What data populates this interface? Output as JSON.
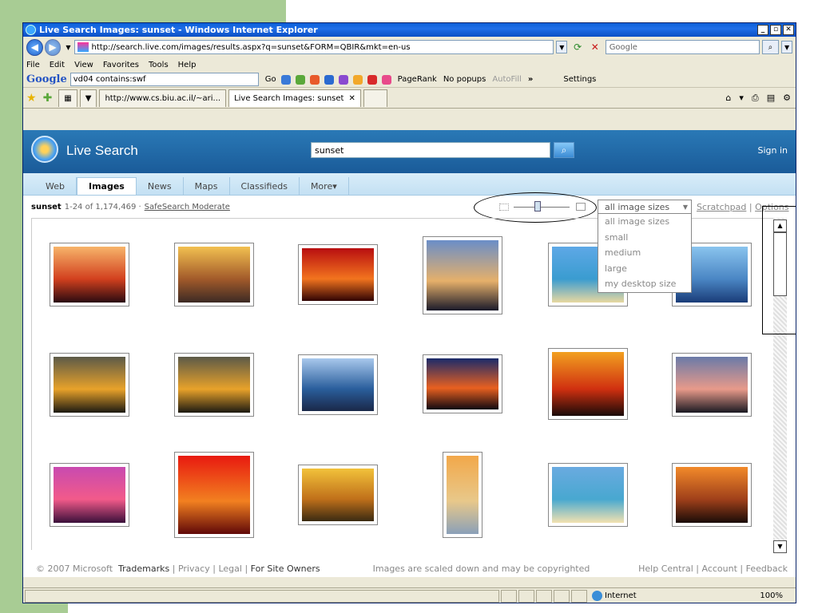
{
  "window": {
    "title": "Live Search Images: sunset - Windows Internet Explorer",
    "url": "http://search.live.com/images/results.aspx?q=sunset&FORM=QBIR&mkt=en-us",
    "search_box_text": "Google"
  },
  "menu": [
    "File",
    "Edit",
    "View",
    "Favorites",
    "Tools",
    "Help"
  ],
  "google_toolbar": {
    "logo": "Google",
    "search_text": "vd04 contains:swf",
    "go_label": "Go",
    "pagerank_label": "PageRank",
    "popups_label": "No popups",
    "autofill_label": "AutoFill",
    "more_label": "»",
    "settings_label": "Settings"
  },
  "tabs": [
    {
      "label": "http://www.cs.biu.ac.il/~ari...",
      "active": false
    },
    {
      "label": "Live Search Images: sunset",
      "active": true
    }
  ],
  "live_search": {
    "brand": "Live Search",
    "query": "sunset",
    "sign_in": "Sign in",
    "nav": [
      "Web",
      "Images",
      "News",
      "Maps",
      "Classifieds",
      "More▾"
    ],
    "selected_nav": "Images",
    "result_query": "sunset",
    "result_count": "1-24 of 1,174,469 ·",
    "safesearch": "SafeSearch Moderate",
    "size_select": "all image sizes",
    "size_options": [
      "all image sizes",
      "small",
      "medium",
      "large",
      "my desktop size"
    ],
    "scratchpad": "Scratchpad",
    "separator": "|",
    "options": "Options"
  },
  "footer": {
    "copyright": "© 2007 Microsoft",
    "links": [
      "Trademarks",
      "Privacy",
      "Legal",
      "For Site Owners"
    ],
    "disclaimer": "Images are scaled down and may be copyrighted",
    "right_links": [
      "Help Central",
      "Account",
      "Feedback"
    ]
  },
  "status": {
    "zone": "Internet",
    "zoom": "100%"
  },
  "colors": {
    "header_blue": "#1a5b99",
    "nav_light_blue": "#c3e0f3"
  },
  "thumbnails": [
    {
      "name": "palm-tree-sunset",
      "colors": [
        "#f7b46a",
        "#d2401e",
        "#2a0a10"
      ]
    },
    {
      "name": "pier-sunset",
      "colors": [
        "#f2c050",
        "#a25a2a",
        "#3c2a24"
      ]
    },
    {
      "name": "red-horizon-sunset",
      "colors": [
        "#b80e10",
        "#f2741e",
        "#300404"
      ]
    },
    {
      "name": "cloudy-coast-sunset",
      "colors": [
        "#6a8ec8",
        "#e6b06a",
        "#1a1a2a"
      ]
    },
    {
      "name": "tropical-beach",
      "colors": [
        "#5ea8e6",
        "#3a9cd0",
        "#e8d8a0"
      ]
    },
    {
      "name": "blue-sea-sunset",
      "colors": [
        "#8ac4ee",
        "#4a86c4",
        "#1a3c78"
      ]
    },
    {
      "name": "rocky-sunset-1",
      "colors": [
        "#5c5a48",
        "#e8a22a",
        "#1c1a12"
      ]
    },
    {
      "name": "rocky-sunset-2",
      "colors": [
        "#5c5a48",
        "#e8a22a",
        "#1c1a12"
      ]
    },
    {
      "name": "blue-clouds",
      "colors": [
        "#a8c8ec",
        "#2a5e9c",
        "#1a2848"
      ]
    },
    {
      "name": "dark-horizon-sunset",
      "colors": [
        "#1a2a6a",
        "#e86020",
        "#100810"
      ]
    },
    {
      "name": "couple-silhouette",
      "colors": [
        "#f2a020",
        "#d03010",
        "#1a0a08"
      ]
    },
    {
      "name": "palm-silhouettes",
      "colors": [
        "#6a7aa8",
        "#e89a8a",
        "#1a1a22"
      ]
    },
    {
      "name": "purple-sunset",
      "colors": [
        "#c84ab0",
        "#f25a8a",
        "#3a103a"
      ]
    },
    {
      "name": "red-sea-sunset",
      "colors": [
        "#e81a10",
        "#f28020",
        "#600808"
      ]
    },
    {
      "name": "golden-clouds",
      "colors": [
        "#f2c23a",
        "#c0701a",
        "#3a2a12"
      ]
    },
    {
      "name": "sailboat-sunset",
      "colors": [
        "#f2a84a",
        "#e8c88a",
        "#8aa0b8"
      ]
    },
    {
      "name": "sandy-beach",
      "colors": [
        "#6aaae0",
        "#48a8d0",
        "#f2e2b0"
      ]
    },
    {
      "name": "orange-silhouettes",
      "colors": [
        "#f28a2a",
        "#a0401a",
        "#1a0c08"
      ]
    }
  ]
}
